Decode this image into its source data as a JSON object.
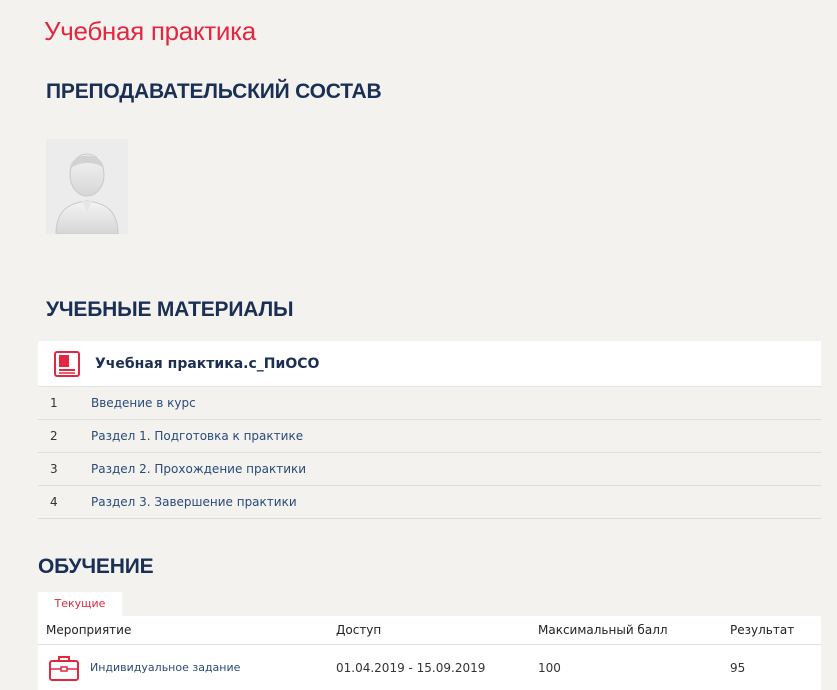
{
  "page_title": "Учебная практика",
  "teachers_title": "ПРЕПОДАВАТЕЛЬСКИЙ СОСТАВ",
  "materials_title": "УЧЕБНЫЕ МАТЕРИАЛЫ",
  "materials": {
    "course_name": "Учебная практика.с_ПиОСО",
    "items": [
      {
        "num": "1",
        "label": "Введение в курс"
      },
      {
        "num": "2",
        "label": "Раздел 1. Подготовка к практике"
      },
      {
        "num": "3",
        "label": "Раздел 2. Прохождение практики"
      },
      {
        "num": "4",
        "label": "Раздел 3. Завершение практики"
      }
    ]
  },
  "learning_title": "ОБУЧЕНИЕ",
  "tabs": {
    "current": "Текущие"
  },
  "table": {
    "headers": [
      "Мероприятие",
      "Доступ",
      "Максимальный балл",
      "Результат"
    ],
    "rows": [
      {
        "event": "Индивидуальное задание",
        "access": "01.04.2019 - 15.09.2019",
        "max": "100",
        "result": "95"
      }
    ]
  },
  "colors": {
    "accent": "#e2273f",
    "heading": "#1b2f55",
    "link": "#2a4a7a",
    "background": "#f3f2ef"
  },
  "icons": {
    "avatar": "user-avatar-placeholder",
    "book": "book-icon",
    "case": "briefcase-icon"
  }
}
